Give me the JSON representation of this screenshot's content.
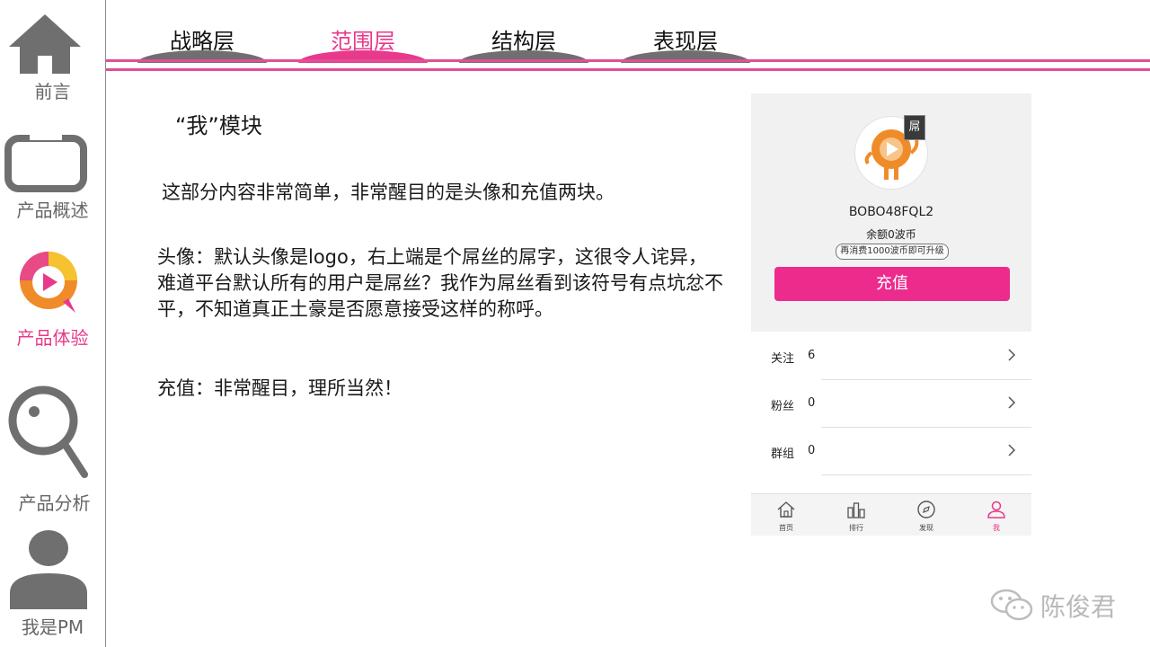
{
  "sidebar": {
    "items": [
      {
        "label": "前言",
        "icon": "home-icon"
      },
      {
        "label": "产品概述",
        "icon": "tv-icon"
      },
      {
        "label": "产品体验",
        "icon": "app-logo-icon",
        "active": true
      },
      {
        "label": "产品分析",
        "icon": "magnifier-icon"
      },
      {
        "label": "我是PM",
        "icon": "person-icon"
      }
    ]
  },
  "tabs": [
    {
      "label": "战略层"
    },
    {
      "label": "范围层",
      "active": true
    },
    {
      "label": "结构层"
    },
    {
      "label": "表现层"
    }
  ],
  "content": {
    "heading": "“我”模块",
    "intro": "这部分内容非常简单，非常醒目的是头像和充值两块。",
    "avatar_paragraph": "头像：默认头像是logo，右上端是个屌丝的屌字，这很令人诧异，难道平台默认所有的用户是屌丝？我作为屌丝看到该符号有点坑忿不平，不知道真正土豪是否愿意接受这样的称呼。",
    "recharge_paragraph": "充值：非常醒目，理所当然！"
  },
  "phone": {
    "badge": "屌",
    "username": "BOBO48FQL2",
    "balance": "余额0波币",
    "upgrade_hint": "再消费1000波币即可升级",
    "recharge_button": "充值",
    "rows": [
      {
        "label": "关注",
        "value": "6"
      },
      {
        "label": "粉丝",
        "value": "0"
      },
      {
        "label": "群组",
        "value": "0"
      }
    ],
    "nav": [
      {
        "label": "首页",
        "icon": "home-outline-icon"
      },
      {
        "label": "排行",
        "icon": "ranking-icon"
      },
      {
        "label": "发现",
        "icon": "compass-icon"
      },
      {
        "label": "我",
        "icon": "user-icon",
        "active": true
      }
    ]
  },
  "watermark": {
    "text": "陈俊君",
    "icon": "wechat-icon"
  },
  "colors": {
    "accent": "#e8398b",
    "button": "#ec2b8c",
    "icon_gray": "#6f6f6f"
  }
}
